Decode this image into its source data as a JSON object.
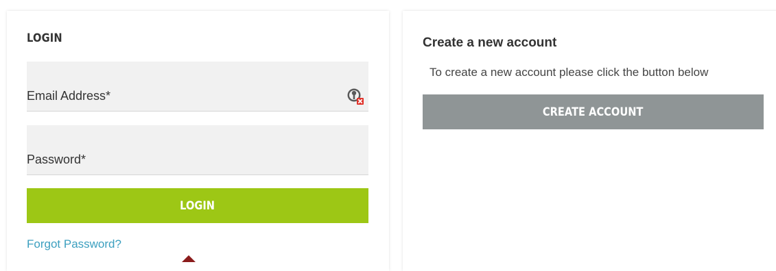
{
  "login": {
    "title": "LOGIN",
    "email_label": "Email Address*",
    "password_label": "Password*",
    "login_button": "LOGIN",
    "forgot_link": "Forgot Password?",
    "key_icon": "password-manager-key-icon"
  },
  "register": {
    "title": "Create a new account",
    "description": "To create a new account please click the button below",
    "create_button": "CREATE ACCOUNT"
  },
  "colors": {
    "login_button": "#9dc715",
    "create_button": "#8f9596",
    "link": "#3b9fbf",
    "field_bg": "#f1f1f1"
  }
}
